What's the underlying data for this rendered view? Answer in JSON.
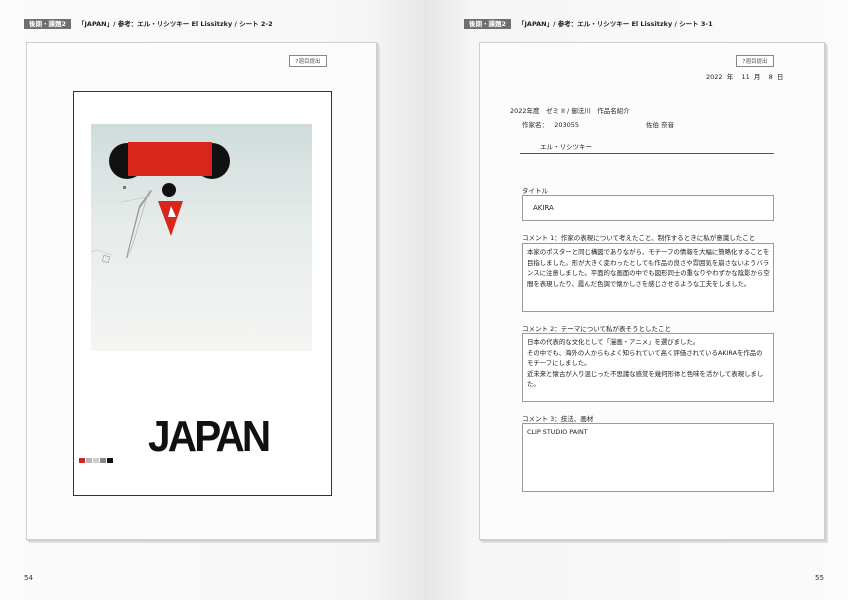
{
  "left_page": {
    "tag": "後期・課題2",
    "header": "「JAPAN」/ 参考：エル・リシツキー El Lissitzky / シート 2-2",
    "stamp": "7週目提出",
    "poster_title": "JAPAN",
    "page_number": "54",
    "swatches": [
      "#c8281e",
      "#b7b7b7",
      "#cfcfcf",
      "#8a8a8a",
      "#111111"
    ]
  },
  "right_page": {
    "tag": "後期・課題2",
    "header": "「JAPAN」/ 参考：エル・リシツキー El Lissitzky / シート 3-1",
    "stamp": "7週目提出",
    "date": {
      "year": "2022",
      "year_unit": "年",
      "month": "11",
      "month_unit": "月",
      "day": "8",
      "day_unit": "日"
    },
    "meta_line": "2022年度　ゼミ II / 御法川　作品名紹介",
    "author_label": "作家名：",
    "author_id": "203055",
    "author_name": "佐伯 奈音",
    "reference_artist": "エル・リシツキー",
    "title_label": "タイトル",
    "title_value": "AKIRA",
    "comment1_label": "コメント 1：作家の表現について考えたこと、制作するときに私が意識したこと",
    "comment1_text": "本家のポスターと同じ構図でありながら、モチーフの情報を大幅に簡略化することを\n目指しました。形が大きく変わったとしても作品の良さや雰囲気を崩さないようバラ\nンスに注意しました。平面的な画面の中でも図形同士の重なりやわずかな陰影から空\n間を表現したり、霞んだ色調で懐かしさを感じさせるような工夫をしました。",
    "comment2_label": "コメント 2：テーマについて私が表そうとしたこと",
    "comment2_text": "日本の代表的な文化として「漫画・アニメ」を選びました。\nその中でも、海外の人からもよく知られていて高く評価されているAKIRAを作品の\nモチーフにしました。\n近未来と懐古が入り混じった不思議な感覚を幾何形体と色味を活かして表現しました。",
    "comment3_label": "コメント 3：技法、画材",
    "comment3_text": "CLIP STUDIO PAINT",
    "page_number": "55"
  },
  "colors": {
    "accent_red": "#d8261d",
    "ink": "#111111",
    "tag_gray": "#6f6f6f"
  }
}
